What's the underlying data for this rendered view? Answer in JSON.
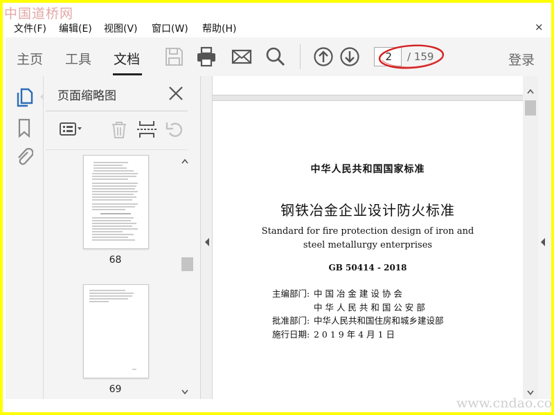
{
  "watermark": {
    "top": "中国道桥网",
    "bottom": "www.cndao.com"
  },
  "menu": {
    "items": [
      "文件(F)",
      "编辑(E)",
      "视图(V)",
      "窗口(W)",
      "帮助(H)"
    ],
    "close_glyph": "×"
  },
  "toolbar": {
    "tabs": [
      "主页",
      "工具",
      "文档"
    ],
    "active_tab": "文档",
    "icons": [
      "save-icon",
      "print-icon",
      "email-icon",
      "search-icon",
      "page-up-icon",
      "page-down-icon"
    ],
    "page_current": "2",
    "page_total": "/ 159",
    "login_label": "登录"
  },
  "left_rail": {
    "icons": [
      "page-thumbnails-icon",
      "bookmark-icon",
      "attachment-icon"
    ]
  },
  "thumbnails_panel": {
    "title": "页面缩略图",
    "tools": [
      "options-menu-icon",
      "delete-icon",
      "insert-page-icon",
      "undo-icon"
    ],
    "pages": [
      {
        "label": "68"
      },
      {
        "label": "69"
      }
    ]
  },
  "document": {
    "title": "中华人民共和国国家标准",
    "name_zh": "钢铁冶金企业设计防火标准",
    "name_en_line1": "Standard for fire protection design of iron and",
    "name_en_line2": "steel metallurgy enterprises",
    "code": "GB 50414 - 2018",
    "meta": [
      {
        "label": "主编部门:",
        "value": "中 国 冶 金 建 设 协 会"
      },
      {
        "label": "",
        "value": "中 华 人 民 共 和 国 公 安 部"
      },
      {
        "label": "批准部门:",
        "value": "中华人民共和国住房和城乡建设部"
      },
      {
        "label": "施行日期:",
        "value": "2 0 1 9 年 4 月 1 日"
      }
    ]
  },
  "colors": {
    "annotation": "#d42020",
    "frame": "#ffff00",
    "toolbar_bg": "#f4f4f4",
    "icon_gray": "#555555",
    "rail_blue": "#2a6db5"
  }
}
